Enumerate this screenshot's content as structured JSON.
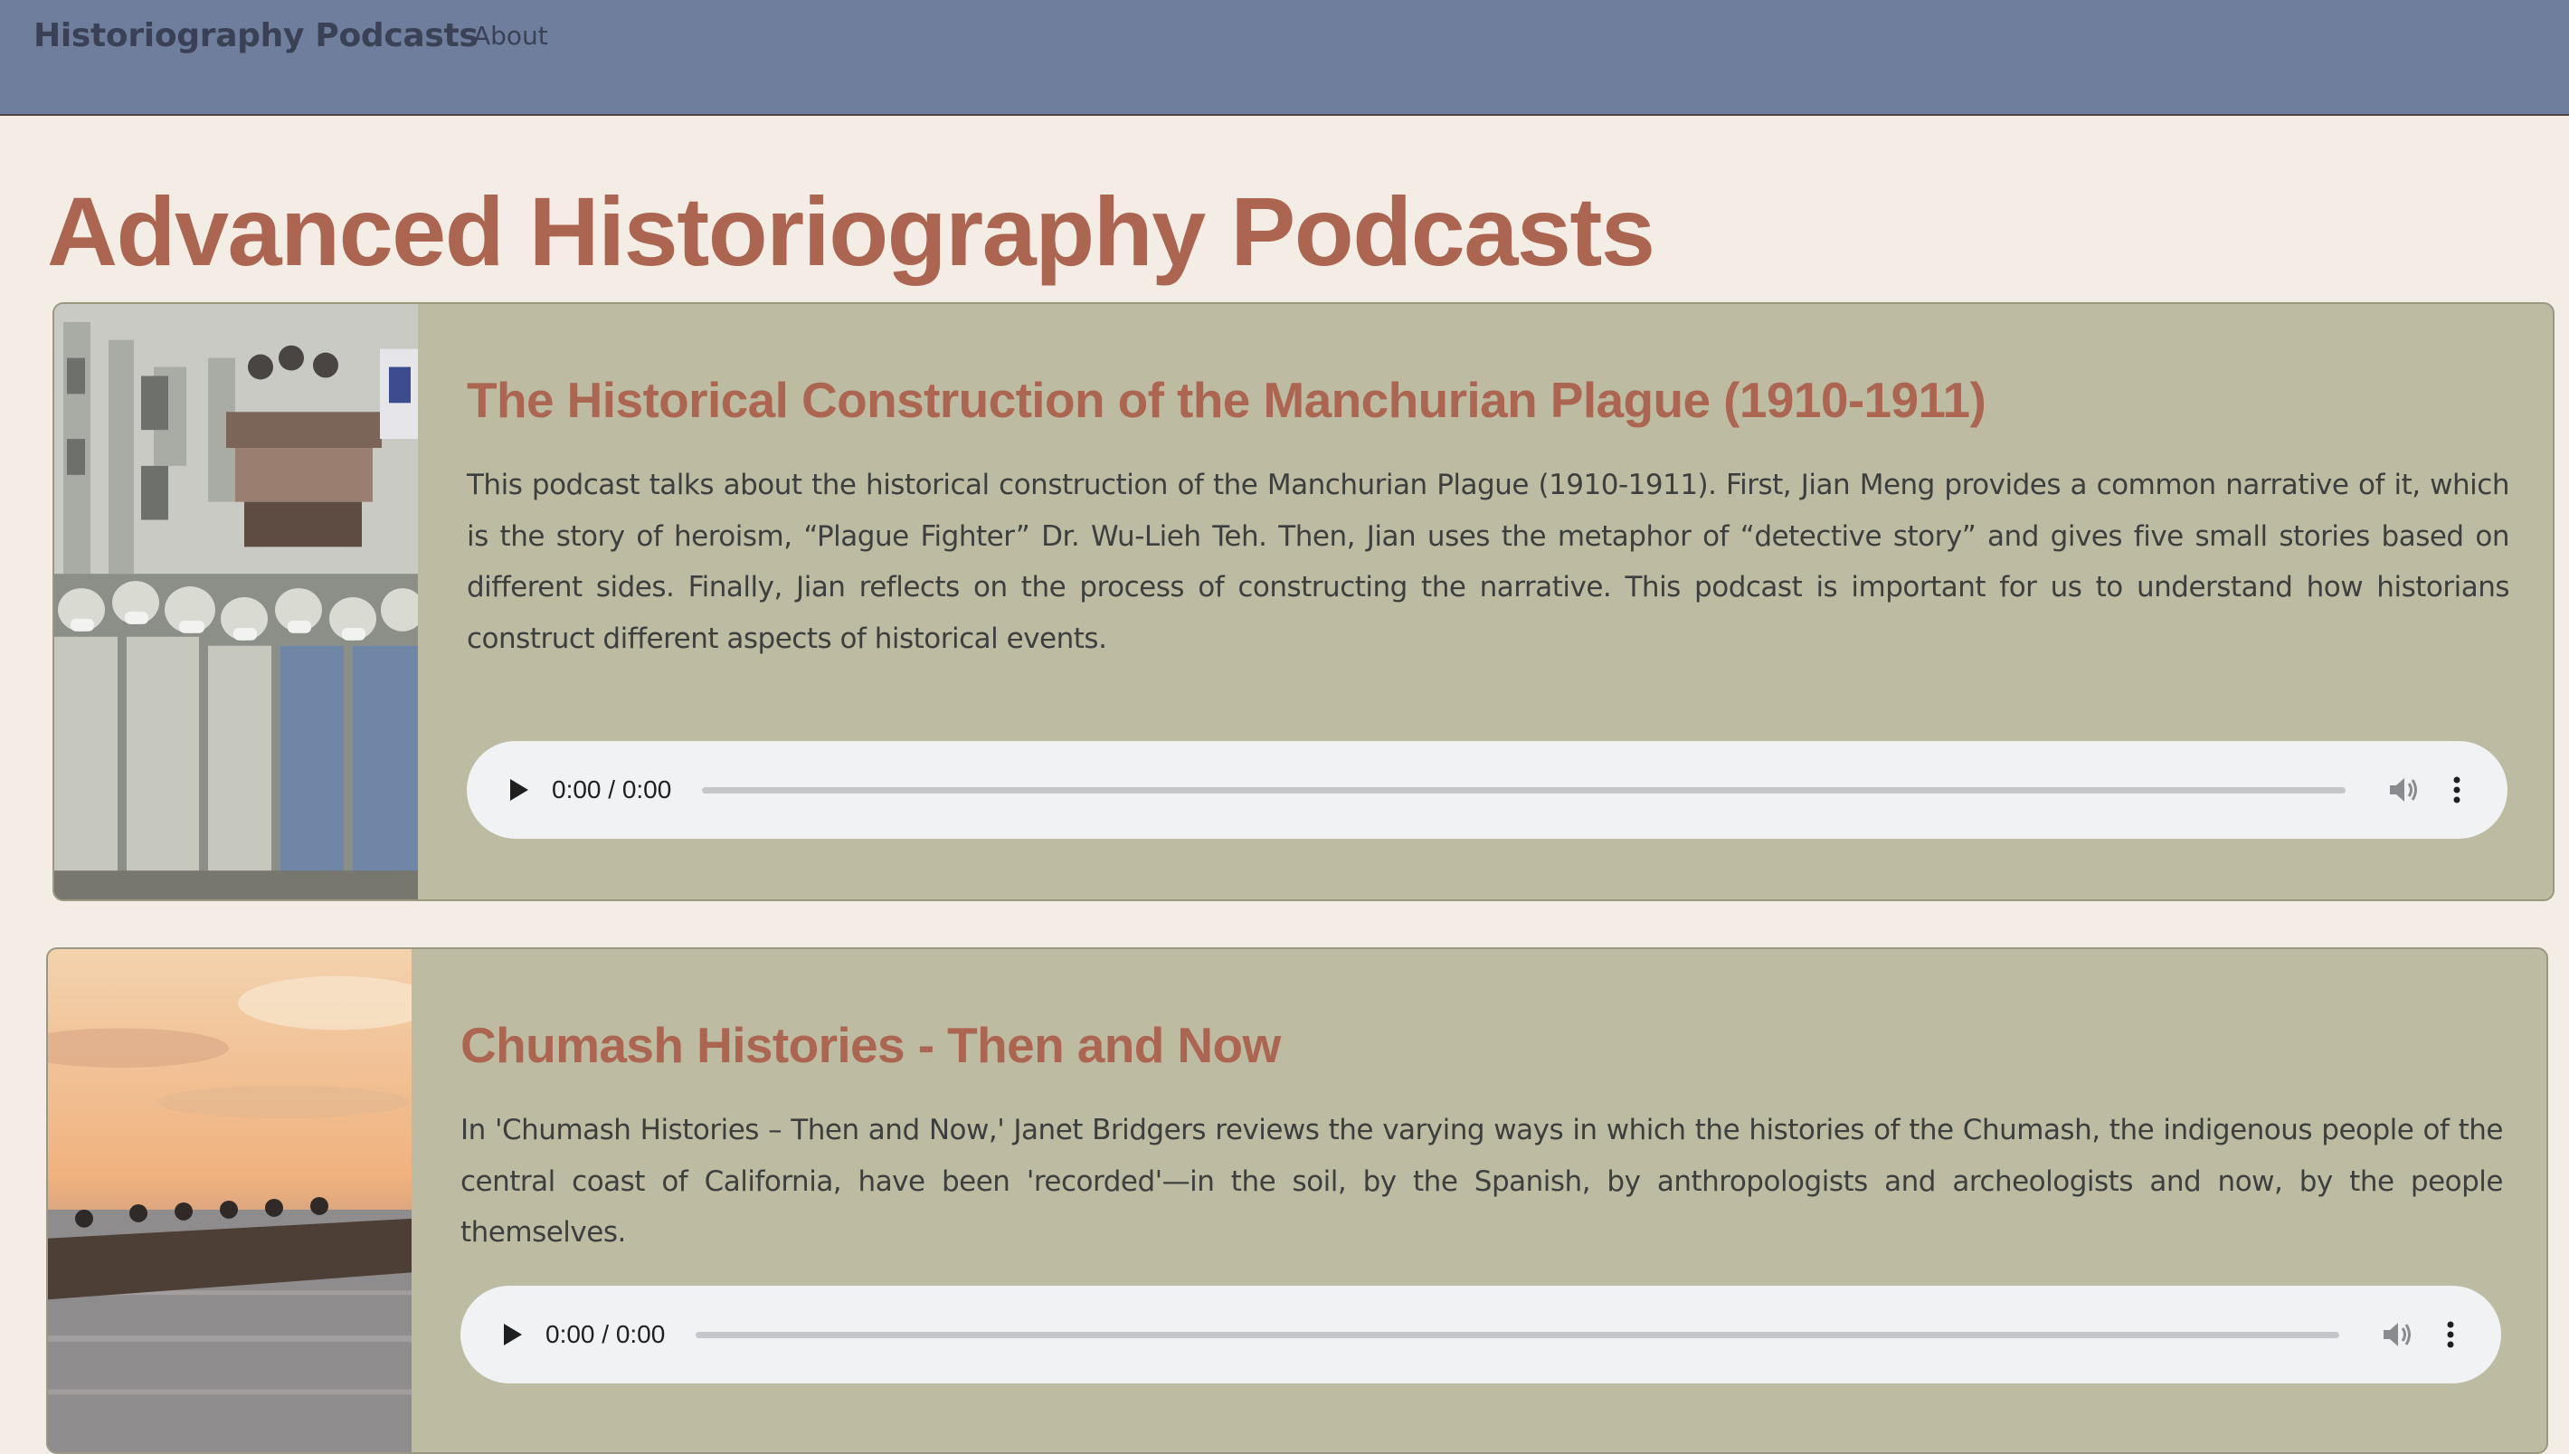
{
  "navbar": {
    "brand": "Historiography Podcasts",
    "links": [
      "About"
    ],
    "background": "#6f7e9c"
  },
  "page": {
    "title": "Advanced Historiography Podcasts",
    "accent_color": "#ac6551",
    "card_color": "#bdbba2"
  },
  "podcasts": [
    {
      "title": "The Historical Construction of the Manchurian Plague (1910-1911)",
      "description": "This podcast talks about the historical construction of the Manchurian Plague (1910-1911). First, Jian Meng provides a common narrative of it, which is the story of heroism, “Plague Fighter” Dr. Wu-Lieh Teh. Then, Jian uses the metaphor of “detective story” and gives five small stories based on different sides. Finally, Jian reflects on the process of constructing the narrative. This podcast is important for us to understand how historians construct different aspects of historical events.",
      "thumbnail": "plague-photo",
      "player": {
        "time": "0:00 / 0:00",
        "progress": 0
      }
    },
    {
      "title": "Chumash Histories - Then and Now",
      "description": "In 'Chumash Histories – Then and Now,' Janet Bridgers reviews the varying ways in which the histories of the Chumash, the indigenous people of the central coast of California, have been 'recorded'—in the soil, by the Spanish, by anthropologists and archeologists and now, by the people themselves.",
      "thumbnail": "canoe-sunset-photo",
      "player": {
        "time": "0:00 / 0:00",
        "progress": 0
      }
    }
  ],
  "icons": {
    "play": "play-icon",
    "volume": "volume-icon",
    "more": "more-vertical-icon"
  }
}
